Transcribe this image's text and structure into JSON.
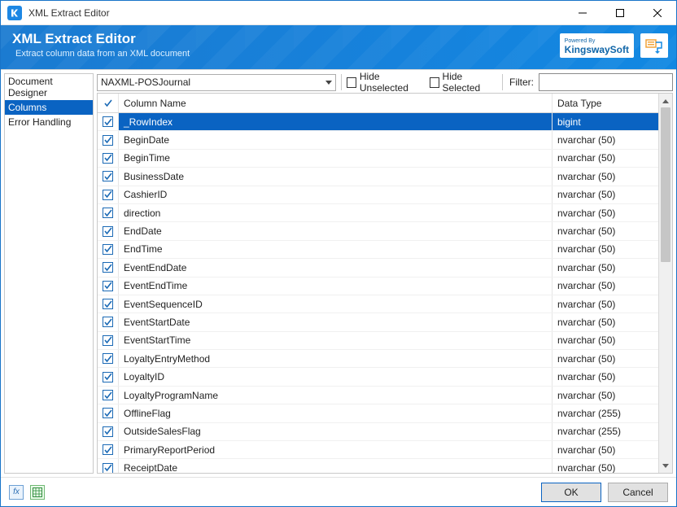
{
  "window": {
    "title": "XML Extract Editor"
  },
  "banner": {
    "heading": "XML Extract Editor",
    "subheading": "Extract column data from an XML document",
    "powered_by": "Powered By",
    "brand": "KingswaySoft"
  },
  "sidebar": {
    "items": [
      {
        "label": "Document Designer",
        "selected": false
      },
      {
        "label": "Columns",
        "selected": true
      },
      {
        "label": "Error Handling",
        "selected": false
      }
    ]
  },
  "toolbar": {
    "dropdown_value": "NAXML-POSJournal",
    "hide_unselected_label": "Hide Unselected",
    "hide_unselected_checked": false,
    "hide_selected_label": "Hide Selected",
    "hide_selected_checked": false,
    "filter_label": "Filter:",
    "filter_value": ""
  },
  "grid": {
    "header_checked": true,
    "columns": {
      "name": "Column Name",
      "type": "Data Type"
    },
    "rows": [
      {
        "checked": true,
        "name": "_RowIndex",
        "type": "bigint",
        "selected": true
      },
      {
        "checked": true,
        "name": "BeginDate",
        "type": "nvarchar (50)",
        "selected": false
      },
      {
        "checked": true,
        "name": "BeginTime",
        "type": "nvarchar (50)",
        "selected": false
      },
      {
        "checked": true,
        "name": "BusinessDate",
        "type": "nvarchar (50)",
        "selected": false
      },
      {
        "checked": true,
        "name": "CashierID",
        "type": "nvarchar (50)",
        "selected": false
      },
      {
        "checked": true,
        "name": "direction",
        "type": "nvarchar (50)",
        "selected": false
      },
      {
        "checked": true,
        "name": "EndDate",
        "type": "nvarchar (50)",
        "selected": false
      },
      {
        "checked": true,
        "name": "EndTime",
        "type": "nvarchar (50)",
        "selected": false
      },
      {
        "checked": true,
        "name": "EventEndDate",
        "type": "nvarchar (50)",
        "selected": false
      },
      {
        "checked": true,
        "name": "EventEndTime",
        "type": "nvarchar (50)",
        "selected": false
      },
      {
        "checked": true,
        "name": "EventSequenceID",
        "type": "nvarchar (50)",
        "selected": false
      },
      {
        "checked": true,
        "name": "EventStartDate",
        "type": "nvarchar (50)",
        "selected": false
      },
      {
        "checked": true,
        "name": "EventStartTime",
        "type": "nvarchar (50)",
        "selected": false
      },
      {
        "checked": true,
        "name": "LoyaltyEntryMethod",
        "type": "nvarchar (50)",
        "selected": false
      },
      {
        "checked": true,
        "name": "LoyaltyID",
        "type": "nvarchar (50)",
        "selected": false
      },
      {
        "checked": true,
        "name": "LoyaltyProgramName",
        "type": "nvarchar (50)",
        "selected": false
      },
      {
        "checked": true,
        "name": "OfflineFlag",
        "type": "nvarchar (255)",
        "selected": false
      },
      {
        "checked": true,
        "name": "OutsideSalesFlag",
        "type": "nvarchar (255)",
        "selected": false
      },
      {
        "checked": true,
        "name": "PrimaryReportPeriod",
        "type": "nvarchar (50)",
        "selected": false
      },
      {
        "checked": true,
        "name": "ReceiptDate",
        "type": "nvarchar (50)",
        "selected": false
      }
    ]
  },
  "footer": {
    "ok_label": "OK",
    "cancel_label": "Cancel"
  }
}
